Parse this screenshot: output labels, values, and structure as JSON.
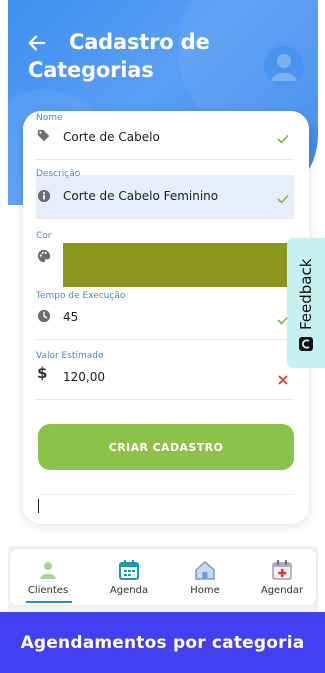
{
  "header": {
    "title": "Cadastro de Categorias",
    "back_icon": "arrow-left-icon",
    "avatar_icon": "user-avatar-icon"
  },
  "form": {
    "fields": [
      {
        "label": "Nome",
        "value": "Corte de Cabelo",
        "icon": "tag-icon",
        "status": "valid"
      },
      {
        "label": "Descrição",
        "value": "Corte de Cabelo Feminino",
        "icon": "info-icon",
        "status": "valid",
        "focused": true
      },
      {
        "label": "Cor",
        "value": "#8a961c",
        "icon": "palette-icon"
      },
      {
        "label": "Tempo de Execução",
        "value": "45",
        "icon": "clock-icon",
        "status": "valid"
      },
      {
        "label": "Valor Estimado",
        "value": "120,00",
        "icon": "dollar-icon",
        "status": "invalid"
      }
    ],
    "submit_label": "CRIAR CADASTRO"
  },
  "feedback": {
    "label": "Feedback",
    "icon": "feedback-icon"
  },
  "bottom_nav": {
    "items": [
      {
        "label": "Clientes",
        "icon": "person-icon",
        "active": true
      },
      {
        "label": "Agenda",
        "icon": "calendar-icon",
        "active": false
      },
      {
        "label": "Home",
        "icon": "home-icon",
        "active": false
      },
      {
        "label": "Agendar",
        "icon": "calendar-plus-icon",
        "active": false
      }
    ]
  },
  "banner": {
    "text": "Agendamentos por categoria"
  },
  "colors": {
    "header": "#3d8ff0",
    "submit": "#8bc34a",
    "valid": "#7cb342",
    "invalid": "#e53935",
    "banner": "#4340f2",
    "feedback": "#c6f1f0"
  }
}
